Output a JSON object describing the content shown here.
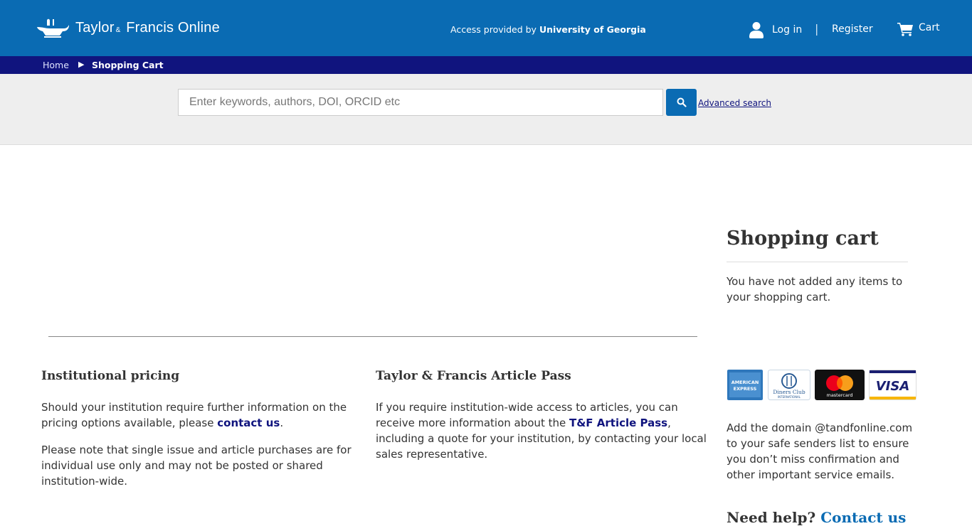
{
  "header": {
    "logo_main": "Taylor",
    "logo_amp": "&",
    "logo_tail": "Francis Online",
    "access_prefix": "Access provided by",
    "access_institution": "University of Georgia",
    "login_label": "Log in",
    "separator": "|",
    "register_label": "Register",
    "cart_label": "Cart",
    "brand_color": "#0a6bb3"
  },
  "breadcrumb": {
    "home": "Home",
    "arrow": "▶",
    "current": "Shopping Cart",
    "bar_color": "#10147e"
  },
  "search": {
    "placeholder": "Enter keywords, authors, DOI, ORCID etc",
    "value": "",
    "advanced_label": "Advanced search",
    "button_icon": "search-icon"
  },
  "cart": {
    "title": "Shopping cart",
    "empty_message": "You have not added any items to your shopping cart."
  },
  "institutional": {
    "heading": "Institutional pricing",
    "p1_before": "Should your institution require further information on the pricing options available, please ",
    "p1_link": "contact us",
    "p1_after": ".",
    "p2": "Please note that single issue and article purchases are for individual use only and may not be posted or shared institution-wide."
  },
  "article_pass": {
    "heading": "Taylor & Francis Article Pass",
    "p_before": "If you require institution-wide access to articles, you can receive more information about the ",
    "p_link": "T&F Article Pass",
    "p_after": ", including a quote for your institution, by contacting your local sales representative."
  },
  "payment": {
    "cards": [
      "american-express-icon",
      "diners-club-icon",
      "mastercard-icon",
      "visa-icon"
    ],
    "amex_text_1": "AMERICAN",
    "amex_text_2": "EXPRESS",
    "diners_text_1": "Diners Club",
    "diners_text_2": "INTERNATIONAL",
    "mastercard_text": "mastercard",
    "visa_text": "VISA"
  },
  "domain_note": "Add the domain @tandfonline.com to your safe senders list to ensure you don’t miss confirmation and other important service emails.",
  "help": {
    "prefix": "Need help? ",
    "link": "Contact us"
  }
}
